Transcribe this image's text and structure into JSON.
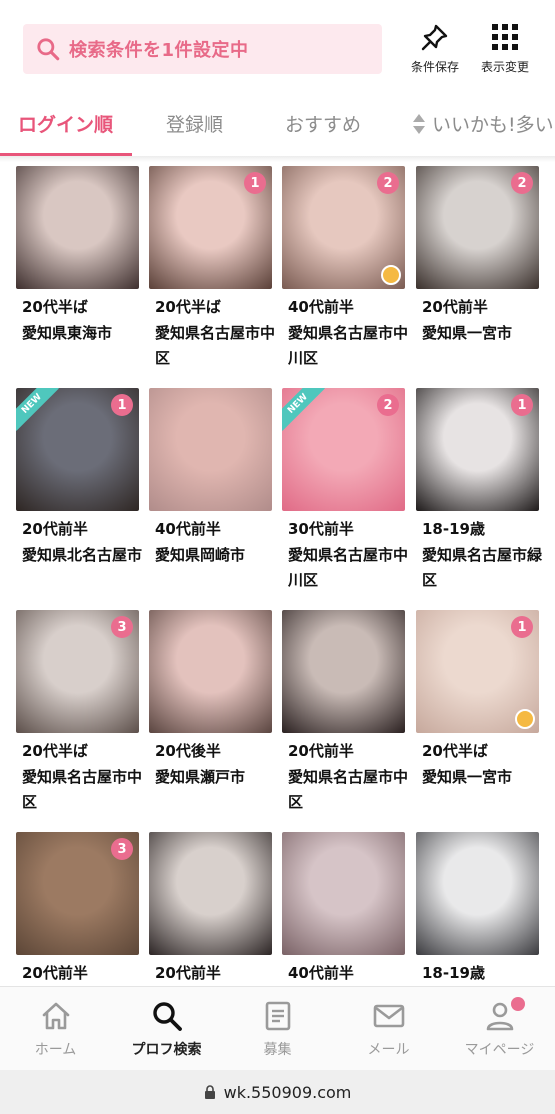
{
  "header": {
    "search_text": "検索条件を1件設定中",
    "save_label": "条件保存",
    "view_label": "表示変更"
  },
  "tabs": [
    {
      "label": "ログイン順",
      "active": true
    },
    {
      "label": "登録順",
      "active": false
    },
    {
      "label": "おすすめ",
      "active": false
    },
    {
      "label": "いいかも!多い",
      "active": false
    }
  ],
  "profiles": [
    {
      "age": "20代半ば",
      "location": "愛知県東海市",
      "badge": "",
      "new": false,
      "star": false,
      "c1": "#d9c7c2",
      "c2": "#3e2f2e"
    },
    {
      "age": "20代半ば",
      "location": "愛知県名古屋市中区",
      "badge": "1",
      "new": false,
      "star": false,
      "c1": "#e9c9c2",
      "c2": "#5a4038"
    },
    {
      "age": "40代前半",
      "location": "愛知県名古屋市中川区",
      "badge": "2",
      "new": false,
      "star": true,
      "c1": "#e6c8bf",
      "c2": "#7a5b52"
    },
    {
      "age": "20代前半",
      "location": "愛知県一宮市",
      "badge": "2",
      "new": false,
      "star": false,
      "c1": "#d7d2cf",
      "c2": "#3a302c"
    },
    {
      "age": "20代前半",
      "location": "愛知県北名古屋市",
      "badge": "1",
      "new": true,
      "star": false,
      "c1": "#6b6d78",
      "c2": "#2e2623"
    },
    {
      "age": "40代前半",
      "location": "愛知県岡崎市",
      "badge": "",
      "new": false,
      "star": false,
      "c1": "#e0b6b0",
      "c2": "#b08c8a"
    },
    {
      "age": "30代前半",
      "location": "愛知県名古屋市中川区",
      "badge": "2",
      "new": true,
      "star": false,
      "c1": "#f3a9b6",
      "c2": "#e06a86"
    },
    {
      "age": "18-19歳",
      "location": "愛知県名古屋市緑区",
      "badge": "1",
      "new": false,
      "star": false,
      "c1": "#e7e3e3",
      "c2": "#1e1a1a"
    },
    {
      "age": "20代半ば",
      "location": "愛知県名古屋市中区",
      "badge": "3",
      "new": false,
      "star": false,
      "c1": "#d8cfcb",
      "c2": "#5c4f4a"
    },
    {
      "age": "20代後半",
      "location": "愛知県瀬戸市",
      "badge": "",
      "new": false,
      "star": false,
      "c1": "#e3c2bd",
      "c2": "#5a4540"
    },
    {
      "age": "20代前半",
      "location": "愛知県名古屋市中区",
      "badge": "",
      "new": false,
      "star": false,
      "c1": "#c9bbb6",
      "c2": "#2a2020"
    },
    {
      "age": "20代半ば",
      "location": "愛知県一宮市",
      "badge": "1",
      "new": false,
      "star": true,
      "c1": "#ecd9cf",
      "c2": "#c6a89c"
    },
    {
      "age": "20代前半",
      "location": "",
      "badge": "3",
      "new": false,
      "star": false,
      "c1": "#9c7a62",
      "c2": "#5c4637"
    },
    {
      "age": "20代前半",
      "location": "",
      "badge": "",
      "new": false,
      "star": false,
      "c1": "#d8d0cc",
      "c2": "#2c2525"
    },
    {
      "age": "40代前半",
      "location": "",
      "badge": "",
      "new": false,
      "star": false,
      "c1": "#d6c4c7",
      "c2": "#7a6266"
    },
    {
      "age": "18-19歳",
      "location": "",
      "badge": "",
      "new": false,
      "star": false,
      "c1": "#e9e9ea",
      "c2": "#3b3b3f"
    }
  ],
  "new_label": "NEW",
  "nav": [
    {
      "label": "ホーム",
      "icon": "home-icon",
      "active": false
    },
    {
      "label": "プロフ検索",
      "icon": "search-icon",
      "active": true
    },
    {
      "label": "募集",
      "icon": "board-icon",
      "active": false
    },
    {
      "label": "メール",
      "icon": "mail-icon",
      "active": false
    },
    {
      "label": "マイページ",
      "icon": "user-icon",
      "active": false
    }
  ],
  "url": "wk.550909.com",
  "colors": {
    "accent": "#e8557a",
    "badge": "#ea6d8f",
    "search_bg": "#fde9ee"
  }
}
